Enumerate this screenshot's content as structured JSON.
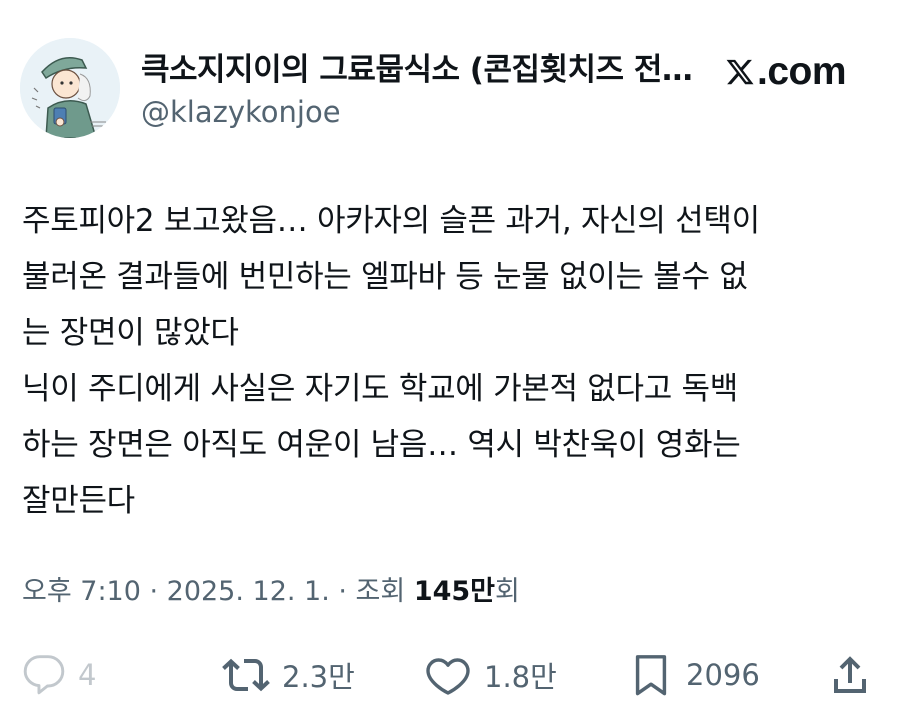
{
  "user": {
    "display_name": "큭소지지이의 그료뭅식소 (콘집횟치즈 전…",
    "handle": "@klazykonjoe",
    "avatar_icon": "avatar-cartoon-person-icon"
  },
  "brand": {
    "logo_text": ".com",
    "logo_icon": "x-logo-icon"
  },
  "tweet": {
    "lines": [
      "주토피아2 보고왔음… 아카자의 슬픈 과거, 자신의 선택이",
      "불러온 결과들에 번민하는 엘파바 등 눈물 없이는 볼수 없",
      "는 장면이 많았다",
      "닉이 주디에게 사실은 자기도 학교에 가본적 없다고 독백",
      "하는 장면은 아직도 여운이 남음… 역시 박찬욱이 영화는",
      "잘만든다"
    ]
  },
  "meta": {
    "timestamp": "오후 7:10 · 2025. 12. 1. · 조회 ",
    "views": "145만",
    "views_suffix": "회"
  },
  "actions": {
    "reply": {
      "icon": "reply-icon",
      "count": "4"
    },
    "retweet": {
      "icon": "retweet-icon",
      "count": "2.3만"
    },
    "like": {
      "icon": "heart-icon",
      "count": "1.8만"
    },
    "bookmark": {
      "icon": "bookmark-icon",
      "count": "2096"
    },
    "share": {
      "icon": "share-icon"
    }
  },
  "colors": {
    "text": "#0f1419",
    "secondary": "#536471",
    "background": "#ffffff"
  }
}
